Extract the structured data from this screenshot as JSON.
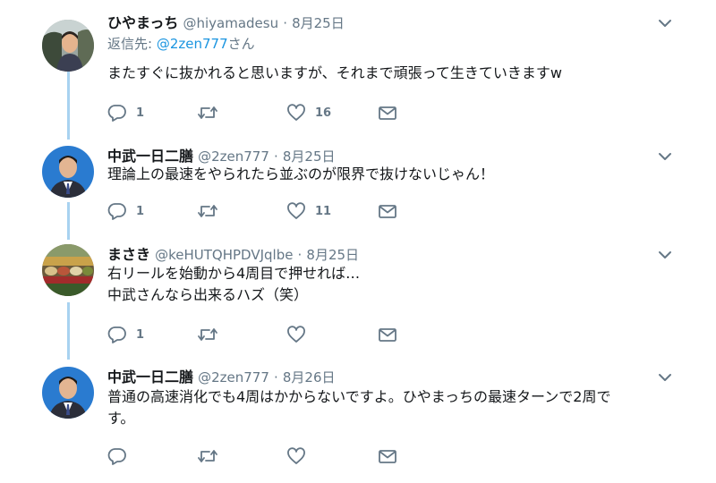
{
  "tweets": [
    {
      "name": "ひやまっち",
      "handle": "@hiyamadesu",
      "separator": "·",
      "date": "8月25日",
      "reply_prefix": "返信先: ",
      "reply_mention": "@2zen777",
      "reply_suffix": "さん",
      "text_lines": [
        "またすぐに抜かれると思いますが、それまで頑張って生きていきますw"
      ],
      "reply_count": "1",
      "like_count": "16",
      "avatar": "outdoor-portrait-avatar"
    },
    {
      "name": "中武一日二膳",
      "handle": "@2zen777",
      "separator": "·",
      "date": "8月25日",
      "text_lines": [
        "理論上の最速をやられたら並ぶのが限界で抜けないじゃん！"
      ],
      "reply_count": "1",
      "like_count": "11",
      "avatar": "suit-portrait-avatar"
    },
    {
      "name": "まさき",
      "handle": "@keHUTQHPDVJqlbe",
      "separator": "·",
      "date": "8月25日",
      "text_lines": [
        "右リールを始動から4周目で押せれば…",
        "中武さんなら出来るハズ（笑）"
      ],
      "reply_count": "1",
      "like_count": "",
      "avatar": "food-photo-avatar"
    },
    {
      "name": "中武一日二膳",
      "handle": "@2zen777",
      "separator": "·",
      "date": "8月26日",
      "text_lines": [
        "普通の高速消化でも4周はかからないですよ。ひやまっちの最速ターンで2周で",
        "す。"
      ],
      "reply_count": "",
      "like_count": "",
      "avatar": "suit-portrait-avatar"
    }
  ],
  "icons": {
    "reply": "reply-icon",
    "retweet": "retweet-icon",
    "like": "heart-icon",
    "dm": "envelope-icon",
    "menu": "chevron-down-icon"
  },
  "colors": {
    "thread_line": "#a8d2f0",
    "mention": "#1b95e0",
    "muted": "#657786"
  }
}
